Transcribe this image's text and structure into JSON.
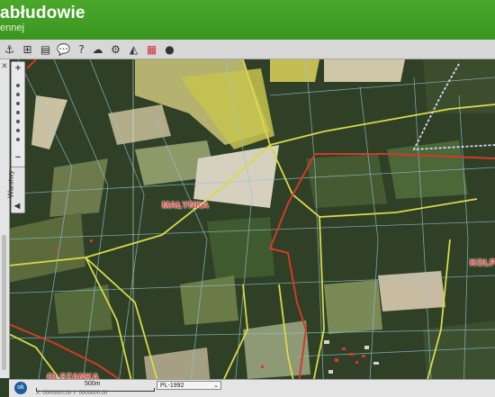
{
  "header": {
    "title": "abłudowie",
    "subtitle": "ennej"
  },
  "toolbar": {
    "tools": [
      {
        "icon": "anchor-icon",
        "glyph": "⚓"
      },
      {
        "icon": "print-layout-icon",
        "glyph": "⊞"
      },
      {
        "icon": "layout-icon",
        "glyph": "▤"
      },
      {
        "icon": "speech-bubble-icon",
        "glyph": "💬"
      },
      {
        "icon": "help-icon",
        "glyph": "?"
      },
      {
        "icon": "cloud-icon",
        "glyph": "☁"
      },
      {
        "icon": "settings-icon",
        "glyph": "⚙"
      },
      {
        "icon": "measure-icon",
        "glyph": "◭"
      },
      {
        "icon": "palette-icon",
        "glyph": "▦"
      },
      {
        "icon": "info-icon",
        "glyph": "●"
      }
    ]
  },
  "sidebar": {
    "close": "✕",
    "zoom_in": "+",
    "zoom_out": "−",
    "layers_tab": "Warstwy",
    "layers_arrow": "◀"
  },
  "map": {
    "labels": {
      "malynka": "MAŁYNKA",
      "kolp": "KOLP",
      "olszanka": "OLSZANKA"
    },
    "colors": {
      "forest": "#2e3f24",
      "field_light": "#b9b28a",
      "field_yellow": "#c9c05a",
      "road": "#d9d94a",
      "parcel": "#8fc7d6",
      "boundary": "#d23a2a",
      "dashed_boundary": "#d8d8f0",
      "label": "#e8413d"
    }
  },
  "status": {
    "ok": "ok",
    "scale_label": "500m",
    "projection": "PL-1992",
    "projection_arrow": "⌄",
    "coords": "X: 0000000.00 Y: 0000000.00"
  }
}
